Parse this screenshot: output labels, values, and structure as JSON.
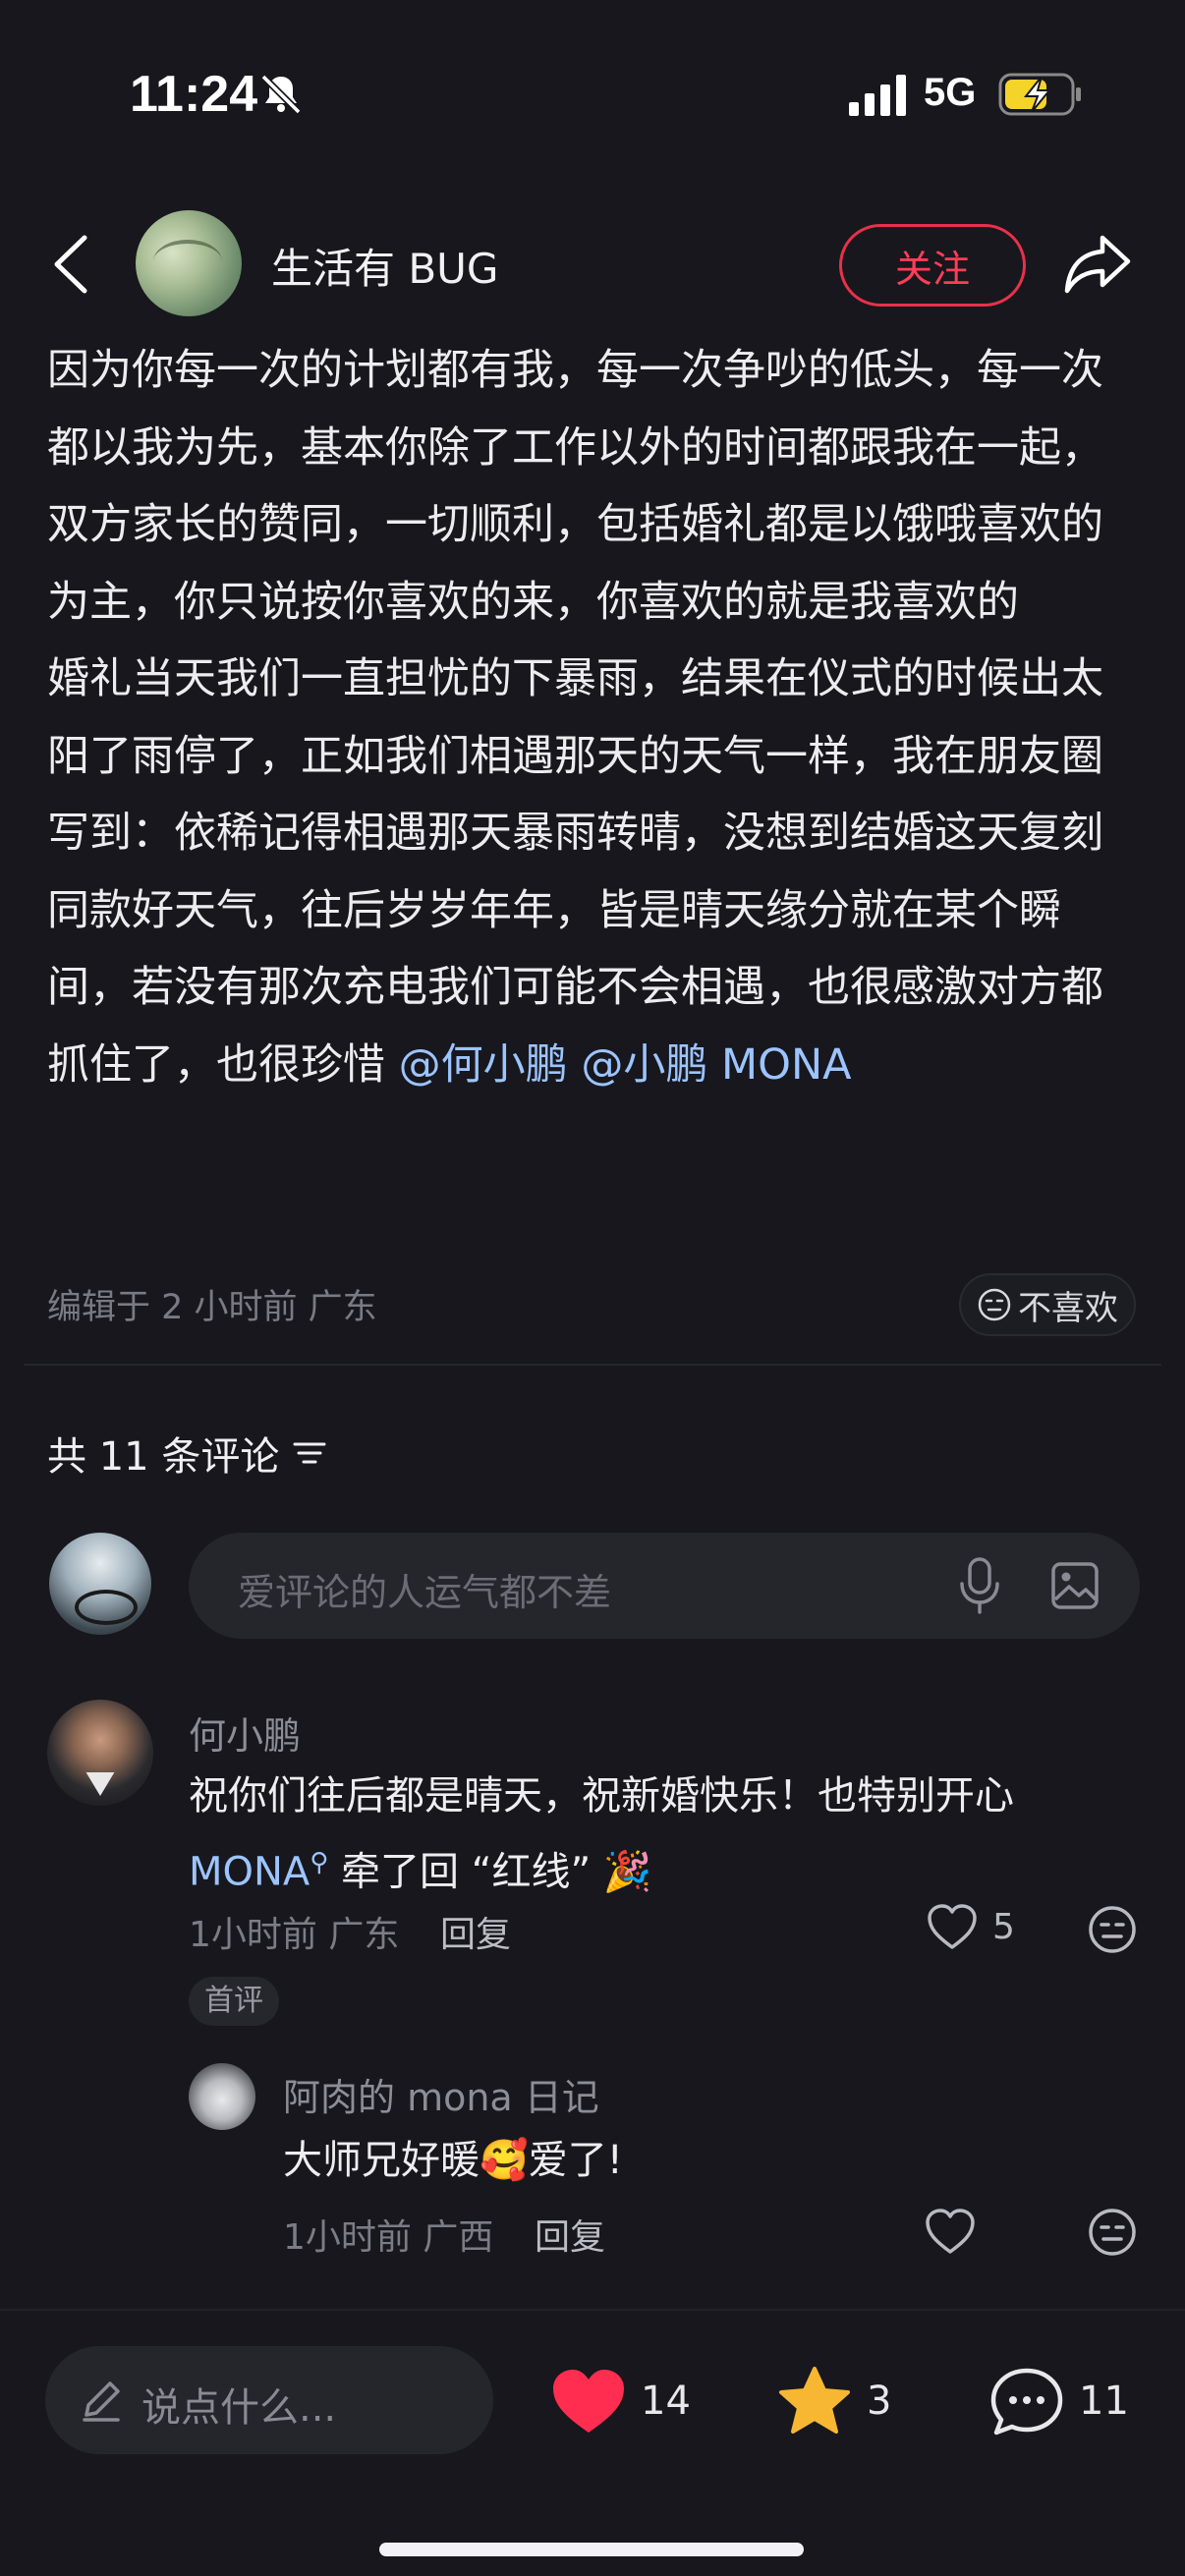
{
  "status_bar": {
    "time": "11:24",
    "network": "5G"
  },
  "header": {
    "author": "生活有 BUG",
    "follow_label": "关注"
  },
  "post": {
    "paragraphs": [
      "因为你每一次的计划都有我，每一次争吵的低头，每一次都以我为先，基本你除了工作以外的时间都跟我在一起，双方家长的赞同，一切顺利，包括婚礼都是以饿哦喜欢的为主，你只说按你喜欢的来，你喜欢的就是我喜欢的",
      "婚礼当天我们一直担忧的下暴雨，结果在仪式的时候出太阳了雨停了，正如我们相遇那天的天气一样，我在朋友圈写到：依稀记得相遇那天暴雨转晴，没想到结婚这天复刻同款好天气，往后岁岁年年，皆是晴天缘分就在某个瞬间，若没有那次充电我们可能不会相遇，也很感激对方都抓住了，也很珍惜"
    ],
    "mentions": [
      "@何小鹏",
      "@小鹏 MONA"
    ],
    "meta": "编辑于 2 小时前 广东",
    "dislike_label": "不喜欢"
  },
  "comments": {
    "count_label": "共 11 条评论",
    "input_placeholder": "爱评论的人运气都不差",
    "items": [
      {
        "name": "何小鹏",
        "text_part1": "祝你们往后都是晴天，祝新婚快乐！也特别开心",
        "link": "MONA",
        "text_part2": " 牵了回 “红线” 🎉",
        "meta": "1小时前 广东",
        "reply_label": "回复",
        "likes": "5",
        "badge": "首评",
        "reply": {
          "name": "阿肉的 mona 日记",
          "text": "大师兄好暖🥰爱了!",
          "meta": "1小时前 广西",
          "reply_label": "回复"
        }
      }
    ]
  },
  "bottom_bar": {
    "input_placeholder": "说点什么...",
    "likes": "14",
    "stars": "3",
    "comments": "11"
  },
  "colors": {
    "accent_red": "#ff3d57",
    "link_blue": "#9cc4ff",
    "star_yellow": "#f7b733",
    "heart_red": "#ff2d4f"
  }
}
